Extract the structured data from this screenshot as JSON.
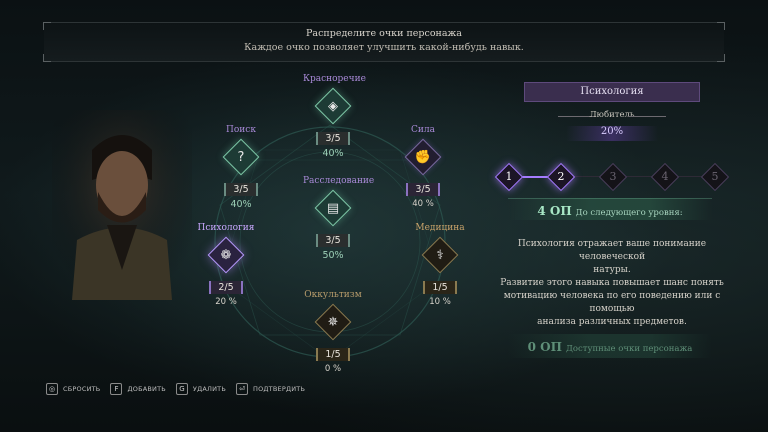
{
  "banner": {
    "line1": "Распределите очки персонажа",
    "line2": "Каждое очко позволяет улучшить какой-нибудь навык."
  },
  "skills": {
    "eloquence": {
      "name": "Красноречие",
      "score": "3/5",
      "pct": "40%",
      "icon": "gems-icon"
    },
    "search": {
      "name": "Поиск",
      "score": "3/5",
      "pct": "40%",
      "icon": "question-icon"
    },
    "strength": {
      "name": "Сила",
      "score": "3/5",
      "pct": "40 %",
      "icon": "fist-icon"
    },
    "investigation": {
      "name": "Расследование",
      "score": "3/5",
      "pct": "50%",
      "icon": "book-icon"
    },
    "psychology": {
      "name": "Психология",
      "score": "2/5",
      "pct": "20 %",
      "icon": "brain-icon"
    },
    "medicine": {
      "name": "Медицина",
      "score": "1/5",
      "pct": "10 %",
      "icon": "caduceus-icon"
    },
    "occultism": {
      "name": "Оккультизм",
      "score": "1/5",
      "pct": "0 %",
      "icon": "sigil-icon"
    }
  },
  "detail": {
    "title": "Психология",
    "rank": "Любитель",
    "chance": "20%",
    "levels": [
      "1",
      "2",
      "3",
      "4",
      "5"
    ],
    "levels_reached": 2,
    "next_points": "4 ОП",
    "next_label": "До следующего уровня:",
    "description": [
      "Психология отражает ваше понимание человеческой",
      "натуры.",
      "Развитие этого навыка повышает шанс понять",
      "мотивацию человека по его поведению или с помощью",
      "анализа различных предметов."
    ],
    "available_points": "0 ОП",
    "available_label": "Доступные очки персонажа"
  },
  "hints": [
    {
      "key": "◎",
      "label": "СБРОСИТЬ"
    },
    {
      "key": "F",
      "label": "ДОБАВИТЬ"
    },
    {
      "key": "G",
      "label": "УДАЛИТЬ"
    },
    {
      "key": "⏎",
      "label": "ПОДТВЕРДИТЬ"
    }
  ],
  "colors": {
    "accent_purple": "#a57cff",
    "accent_green": "#7fc9a8",
    "title_bg": "#3a2e4e"
  }
}
